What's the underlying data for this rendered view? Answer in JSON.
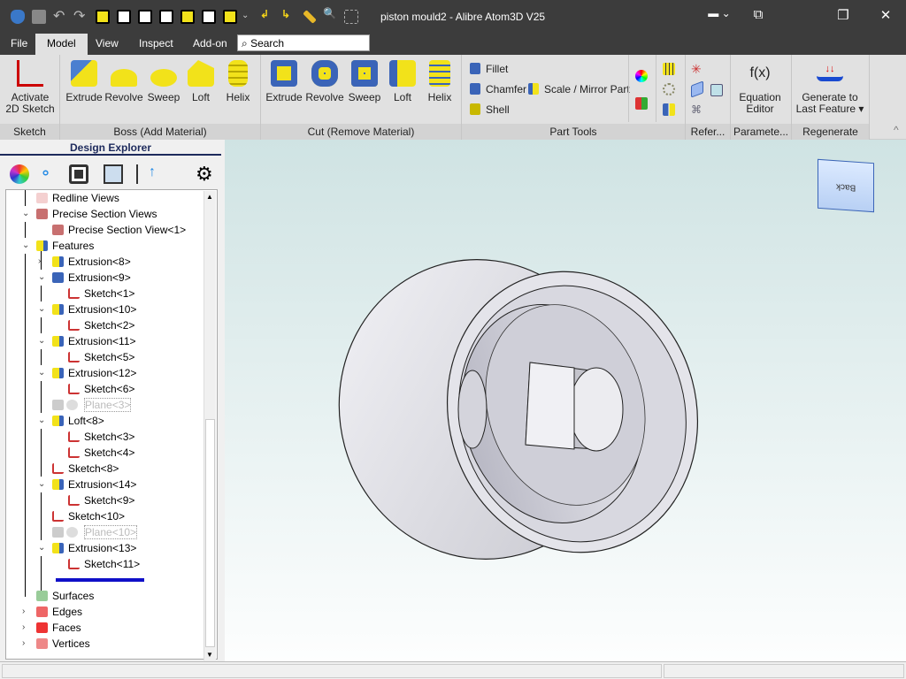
{
  "window": {
    "title": "piston mould2 - Alibre Atom3D V25",
    "controls": [
      "—",
      "⧉",
      "❐",
      "✕"
    ]
  },
  "menu": {
    "tabs": [
      "File",
      "Model",
      "View",
      "Inspect",
      "Add-on"
    ],
    "active": "Model",
    "search_placeholder": "Search",
    "help": "?"
  },
  "ribbon": {
    "sketch": {
      "activate": [
        "Activate",
        "2D Sketch"
      ],
      "group": "Sketch"
    },
    "boss": {
      "items": [
        "Extrude",
        "Revolve",
        "Sweep",
        "Loft",
        "Helix"
      ],
      "group": "Boss (Add Material)"
    },
    "cut": {
      "items": [
        "Extrude",
        "Revolve",
        "Sweep",
        "Loft",
        "Helix"
      ],
      "group": "Cut (Remove Material)"
    },
    "part_tools": {
      "fillet": "Fillet",
      "chamfer": "Chamfer",
      "scale_mirror": "Scale / Mirror Part",
      "shell": "Shell",
      "group": "Part Tools"
    },
    "refer": {
      "group": "Refer..."
    },
    "params": {
      "symbol": "f(x)",
      "label": [
        "Equation",
        "Editor"
      ],
      "group": "Paramete..."
    },
    "regen": {
      "label": [
        "Generate to",
        "Last Feature ▾"
      ],
      "group": "Regenerate"
    },
    "collapse": "^"
  },
  "explorer": {
    "title": "Design Explorer",
    "tree": [
      {
        "label": "Redline Views",
        "level": 0,
        "icon": "redline"
      },
      {
        "label": "Precise Section Views",
        "level": 0,
        "icon": "section",
        "expanded": true
      },
      {
        "label": "Precise Section View<1>",
        "level": 1,
        "icon": "section"
      },
      {
        "label": "Features",
        "level": 0,
        "icon": "feature",
        "expanded": true
      },
      {
        "label": "Extrusion<8>",
        "level": 1,
        "icon": "extrude",
        "expanded": false
      },
      {
        "label": "Extrusion<9>",
        "level": 1,
        "icon": "extrude-cut",
        "expanded": true
      },
      {
        "label": "Sketch<1>",
        "level": 2,
        "icon": "sketch"
      },
      {
        "label": "Extrusion<10>",
        "level": 1,
        "icon": "extrude",
        "expanded": true
      },
      {
        "label": "Sketch<2>",
        "level": 2,
        "icon": "sketch"
      },
      {
        "label": "Extrusion<11>",
        "level": 1,
        "icon": "extrude",
        "expanded": true
      },
      {
        "label": "Sketch<5>",
        "level": 2,
        "icon": "sketch"
      },
      {
        "label": "Extrusion<12>",
        "level": 1,
        "icon": "extrude",
        "expanded": true
      },
      {
        "label": "Sketch<6>",
        "level": 2,
        "icon": "sketch"
      },
      {
        "label": "Plane<3>",
        "level": 1,
        "icon": "plane",
        "hidden": true
      },
      {
        "label": "Loft<8>",
        "level": 1,
        "icon": "loft",
        "expanded": true
      },
      {
        "label": "Sketch<3>",
        "level": 2,
        "icon": "sketch"
      },
      {
        "label": "Sketch<4>",
        "level": 2,
        "icon": "sketch"
      },
      {
        "label": "Sketch<8>",
        "level": 1,
        "icon": "sketch"
      },
      {
        "label": "Extrusion<14>",
        "level": 1,
        "icon": "extrude",
        "expanded": true
      },
      {
        "label": "Sketch<9>",
        "level": 2,
        "icon": "sketch"
      },
      {
        "label": "Sketch<10>",
        "level": 1,
        "icon": "sketch"
      },
      {
        "label": "Plane<10>",
        "level": 1,
        "icon": "plane",
        "hidden": true
      },
      {
        "label": "Extrusion<13>",
        "level": 1,
        "icon": "extrude",
        "expanded": true
      },
      {
        "label": "Sketch<11>",
        "level": 2,
        "icon": "sketch"
      },
      {
        "label": "",
        "level": 1,
        "icon": "rollback-bar"
      },
      {
        "label": "Surfaces",
        "level": 0,
        "icon": "surface"
      },
      {
        "label": "Edges",
        "level": 0,
        "icon": "edge",
        "expanded": false
      },
      {
        "label": "Faces",
        "level": 0,
        "icon": "face",
        "expanded": false
      },
      {
        "label": "Vertices",
        "level": 0,
        "icon": "vertex",
        "expanded": false
      }
    ]
  },
  "viewport": {
    "view_cube_face": "Back"
  }
}
